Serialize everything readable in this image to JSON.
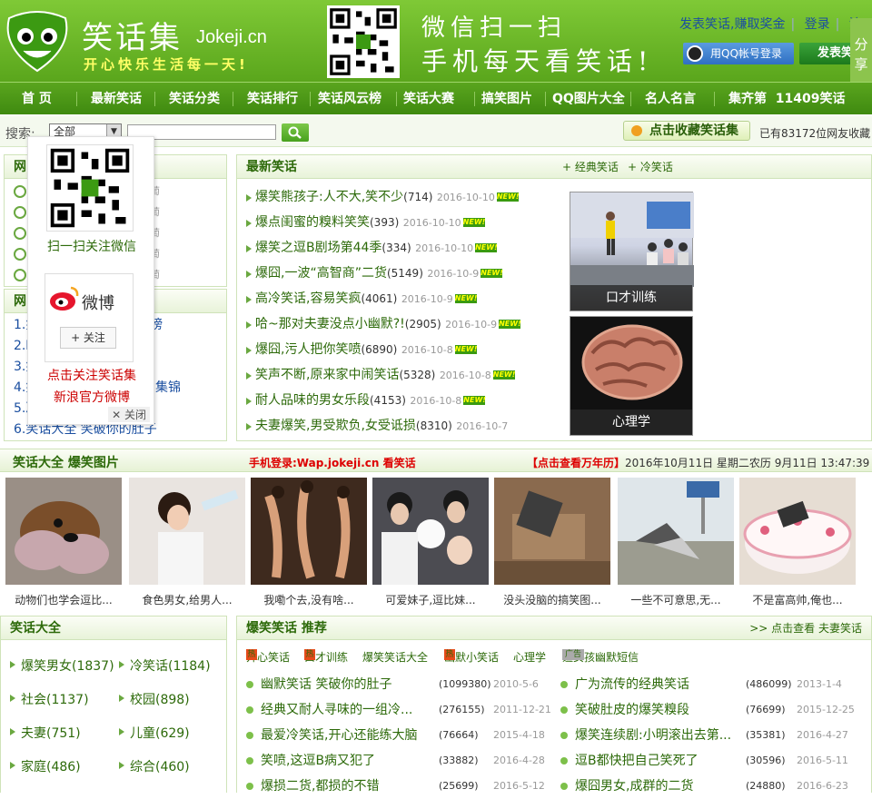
{
  "header": {
    "logo_title": "笑话集",
    "logo_domain": "Jokeji.cn",
    "slogan": "开心快乐生活每一天!",
    "wechat_line1": "微信扫一扫",
    "wechat_line2": "手机每天看笑话!",
    "link_post_earn": "发表笑话,赚取奖金",
    "link_login": "登录",
    "link_register": "注",
    "qq_login": "用QQ帐号登录",
    "post_button": "发表笑",
    "share_tab": "分享"
  },
  "nav": {
    "items": [
      "首 页",
      "最新笑话",
      "笑话分类",
      "笑话排行",
      "笑话风云榜",
      "笑话大赛",
      "搞笑图片",
      "QQ图片大全",
      "名人名言"
    ],
    "count_label": "集齐第",
    "count_value": "11409笑话"
  },
  "search": {
    "label": "搜索:",
    "select_value": "全部",
    "favorite_button": "点击收藏笑话集",
    "favorite_count": "已有83172位网友收藏"
  },
  "left_top": {
    "title": "网",
    "time_rows": [
      "萄",
      "萄",
      "萄",
      "萄",
      "萄"
    ]
  },
  "left_rank": {
    "title": "网",
    "rows": [
      "1.笑",
      "2.幽",
      "3.笑",
      "4.笑",
      "5.冷",
      "6.笑话大全 笑破你的肚子"
    ],
    "row_suffix": [
      "榜",
      "",
      "",
      "集锦",
      "",
      ""
    ]
  },
  "popup": {
    "wechat_caption": "扫一扫关注微信",
    "weibo_label": "微博",
    "follow_button": "+ 关注",
    "weibo_caption1": "点击关注笑话集",
    "weibo_caption2": "新浪官方微博",
    "close": "✕ 关闭"
  },
  "latest": {
    "title": "最新笑话",
    "more1": "+ 经典笑话",
    "more2": "+ 冷笑话",
    "new_badge": "NEW!",
    "items": [
      {
        "title": "爆笑熊孩子:人不大,笑不少",
        "count": "(714)",
        "date": "2016-10-10",
        "new": true
      },
      {
        "title": "爆点闺蜜的糗料笑笑",
        "count": "(393)",
        "date": "2016-10-10",
        "new": true
      },
      {
        "title": "爆笑之逗B剧场第44季",
        "count": "(334)",
        "date": "2016-10-10",
        "new": true
      },
      {
        "title": "爆囧,一波“高智商”二货",
        "count": "(5149)",
        "date": "2016-10-9",
        "new": true
      },
      {
        "title": "高冷笑话,容易笑疯",
        "count": "(4061)",
        "date": "2016-10-9",
        "new": true
      },
      {
        "title": "哈~那对夫妻没点小幽默?!",
        "count": "(2905)",
        "date": "2016-10-9",
        "new": true
      },
      {
        "title": "爆囧,污人把你笑喷",
        "count": "(6890)",
        "date": "2016-10-8",
        "new": true
      },
      {
        "title": "笑声不断,原来家中闹笑话",
        "count": "(5328)",
        "date": "2016-10-8",
        "new": true
      },
      {
        "title": "耐人品味的男女乐段",
        "count": "(4153)",
        "date": "2016-10-8",
        "new": true
      },
      {
        "title": "夫妻爆笑,男受欺负,女受诋损",
        "count": "(8310)",
        "date": "2016-10-7",
        "new": false
      }
    ],
    "side_pics": [
      "口才训练",
      "心理学"
    ]
  },
  "strip": {
    "title": "笑话大全 爆笑图片",
    "mobile": "手机登录:Wap.jokeji.cn 看笑话",
    "calendar": "【点击查看万年历】",
    "datetime": "2016年10月11日 星期二农历 9月11日 13:47:39"
  },
  "pictures": [
    {
      "caption": "动物们也学会逗比..."
    },
    {
      "caption": "食色男女,给男人..."
    },
    {
      "caption": "我嘞个去,没有啥..."
    },
    {
      "caption": "可爱妹子,逗比妹..."
    },
    {
      "caption": "没头没脑的搞笑图..."
    },
    {
      "caption": "一些不可意思,无..."
    },
    {
      "caption": "不是富高帅,俺也..."
    }
  ],
  "categories": {
    "title": "笑话大全",
    "items": [
      "爆笑男女(1837)",
      "冷笑话(1184)",
      "社会(1137)",
      "校园(898)",
      "夫妻(751)",
      "儿童(629)",
      "家庭(486)",
      "综合(460)"
    ]
  },
  "recommend": {
    "title": "爆笑笑话 推荐",
    "more": ">> 点击查看 夫妻笑话",
    "hot_badge": "热",
    "ad_badge": "广告",
    "tags": [
      "开心笑话",
      "口才训练",
      "爆笑笑话大全",
      "幽默小笑话",
      "心理学",
      "追女孩幽默短信"
    ],
    "rows": [
      {
        "title": "幽默笑话 笑破你的肚子",
        "count": "(1099380)",
        "date": "2010-5-6"
      },
      {
        "title": "广为流传的经典笑话",
        "count": "(486099)",
        "date": "2013-1-4"
      },
      {
        "title": "经典又耐人寻味的一组冷...",
        "count": "(276155)",
        "date": "2011-12-21"
      },
      {
        "title": "笑破肚皮的爆笑糗段",
        "count": "(76699)",
        "date": "2015-12-25"
      },
      {
        "title": "最爱冷笑话,开心还能练大脑",
        "count": "(76664)",
        "date": "2015-4-18"
      },
      {
        "title": "爆笑连续剧:小明滚出去第...",
        "count": "(35381)",
        "date": "2016-4-27"
      },
      {
        "title": "笑喷,这逗B病又犯了",
        "count": "(33882)",
        "date": "2016-4-28"
      },
      {
        "title": "逗B都快把自己笑死了",
        "count": "(30596)",
        "date": "2016-5-11"
      },
      {
        "title": "爆损二货,都损的不错",
        "count": "(25699)",
        "date": "2016-5-12"
      },
      {
        "title": "爆囧男女,成群的二货",
        "count": "(24880)",
        "date": "2016-6-23"
      }
    ]
  },
  "colors": {
    "brand_green": "#5aa61c",
    "link_blue": "#1b4fa0",
    "title_green": "#2d6a0a",
    "alert_red": "#dd0000"
  }
}
